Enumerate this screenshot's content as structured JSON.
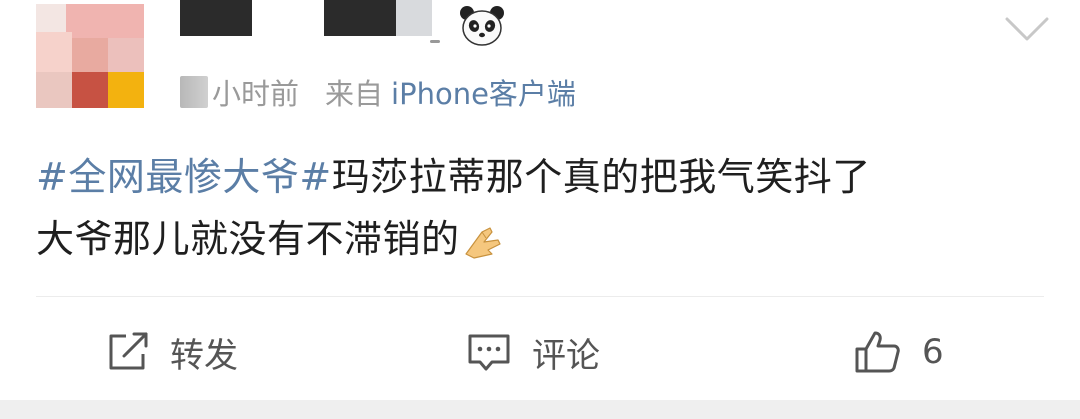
{
  "post": {
    "meta": {
      "time": "小时前",
      "from_label": "来自",
      "device": "iPhone客户端"
    },
    "content": {
      "hashtag": "#全网最惨大爷#",
      "line1_rest": "玛莎拉蒂那个真的把我气笑抖了",
      "line2": "大爷那儿就没有不滞销的"
    },
    "actions": {
      "repost_label": "转发",
      "comment_label": "评论",
      "like_count": "6"
    },
    "icons": [
      "panda-icon",
      "chevron-down-icon",
      "folded-hands-emoji",
      "share-icon",
      "comment-icon",
      "thumbs-up-icon"
    ],
    "colors": {
      "hashtag": "#5b7ea6",
      "meta": "#9a9a9a",
      "text": "#1f1f1f"
    }
  }
}
